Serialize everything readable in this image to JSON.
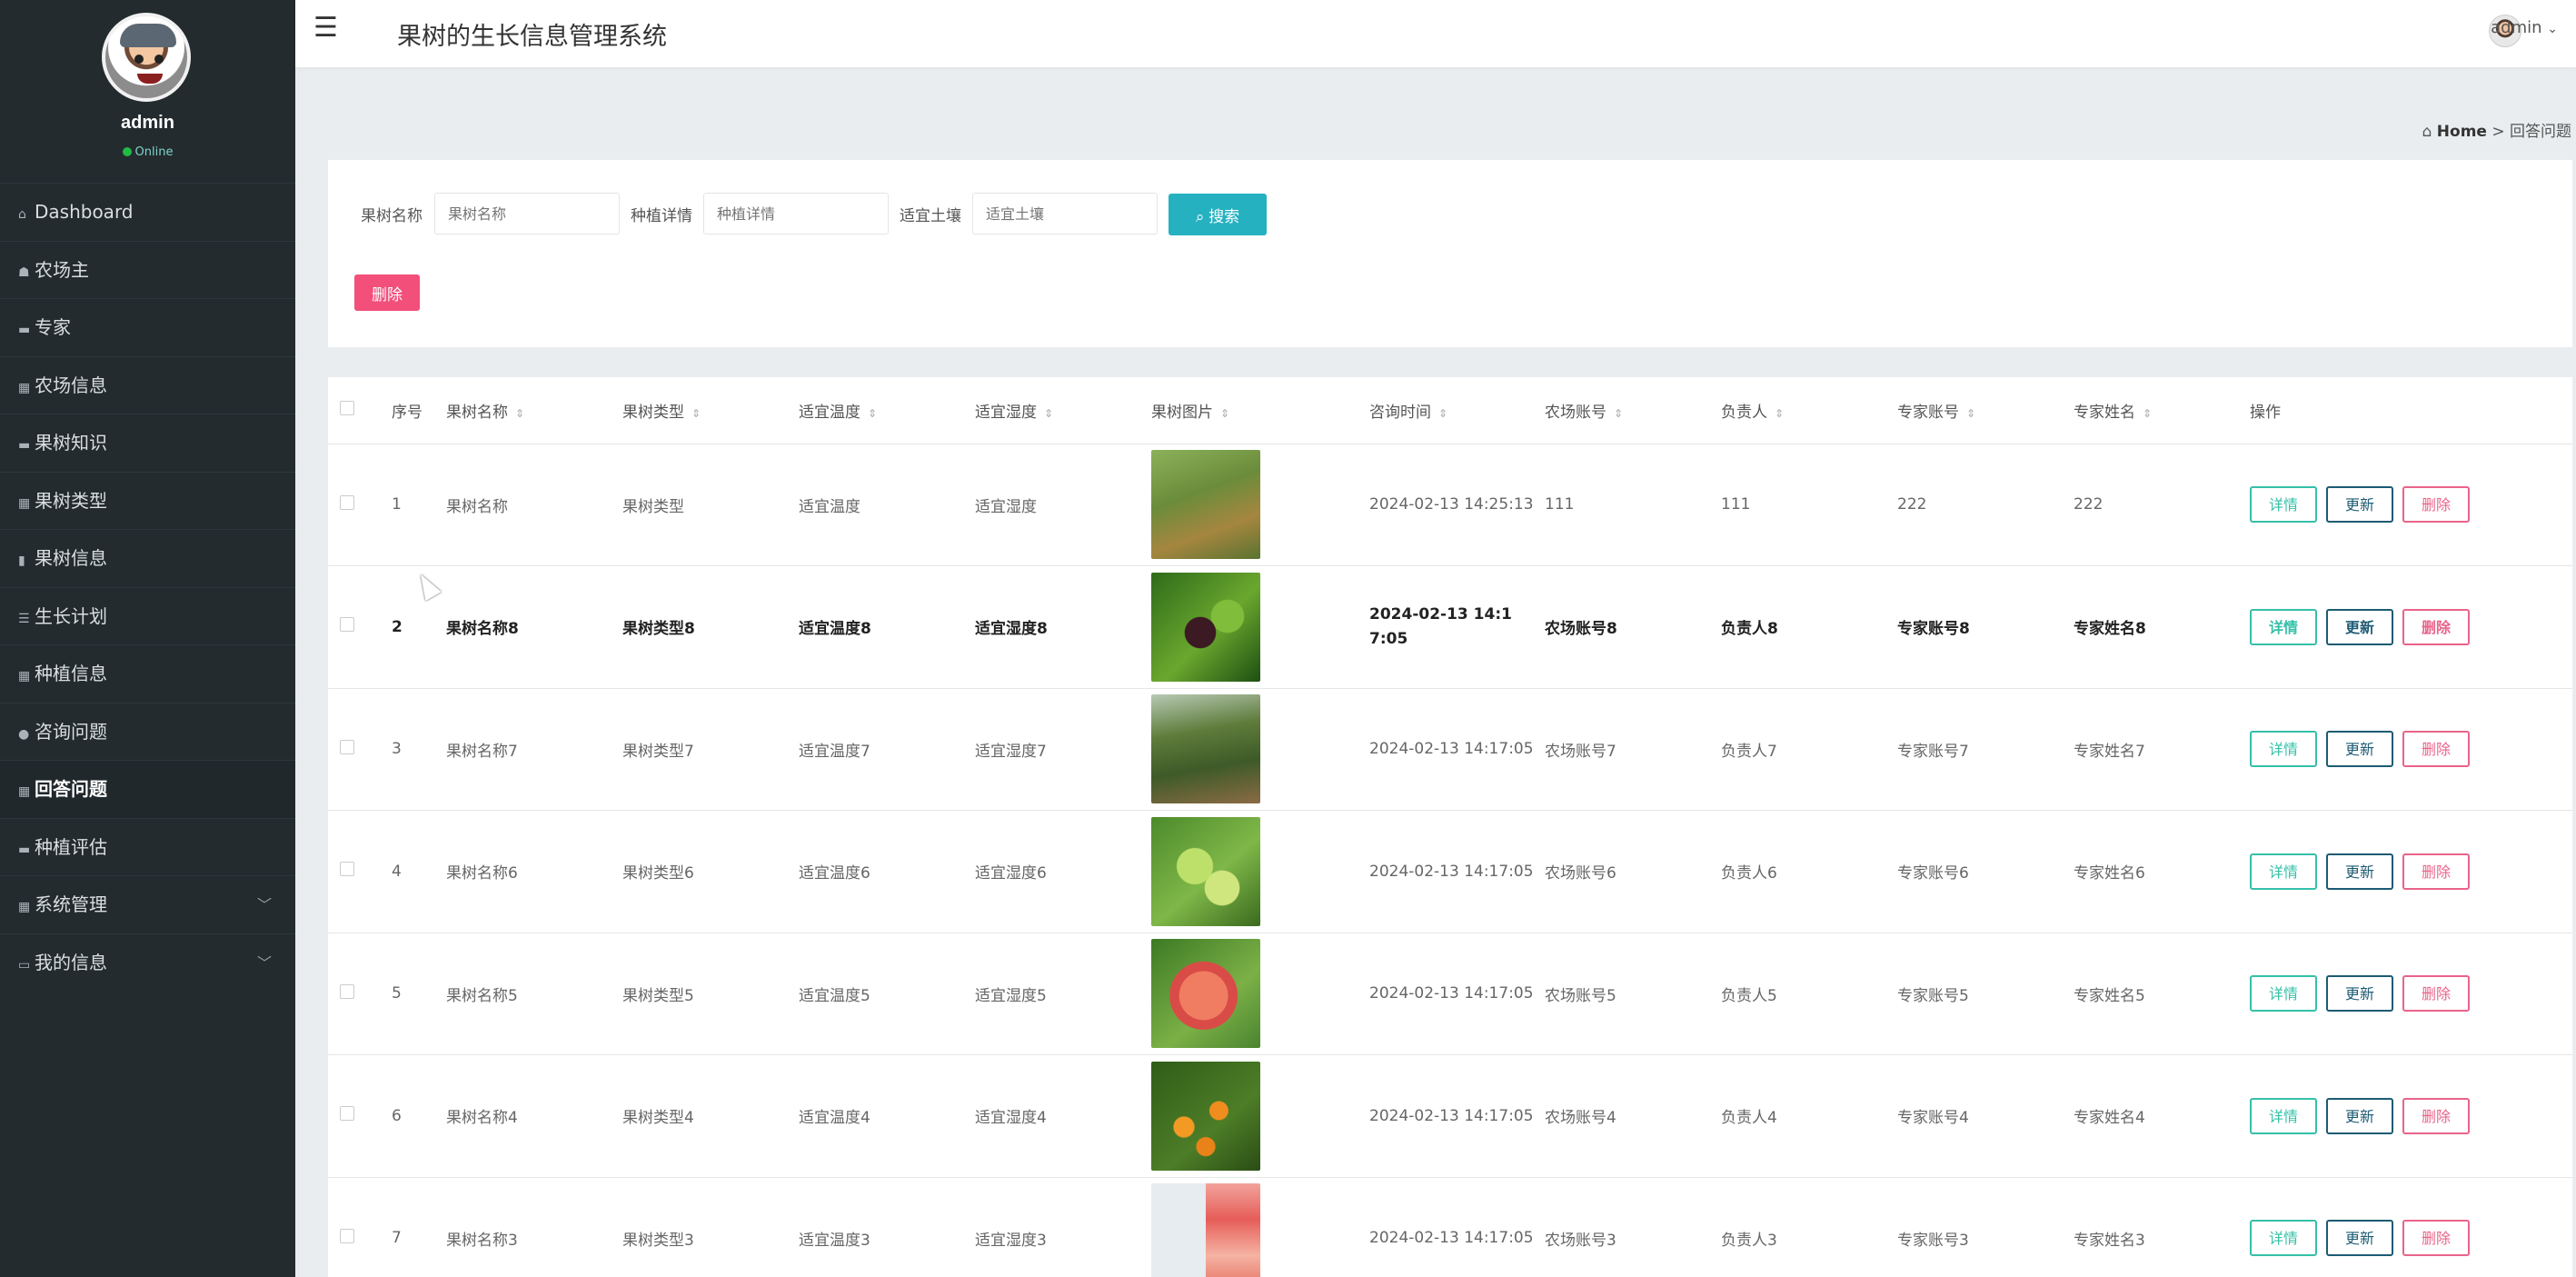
{
  "app": {
    "title": "果树的生长信息管理系统",
    "top_user": "admin"
  },
  "sidebar": {
    "username": "admin",
    "status": "Online",
    "items": [
      {
        "label": "Dashboard",
        "icon": "home-icon"
      },
      {
        "label": "农场主",
        "icon": "user-icon"
      },
      {
        "label": "专家",
        "icon": "user-icon"
      },
      {
        "label": "农场信息",
        "icon": "grid-icon"
      },
      {
        "label": "果树知识",
        "icon": "book-icon"
      },
      {
        "label": "果树类型",
        "icon": "grid-icon"
      },
      {
        "label": "果树信息",
        "icon": "book-icon"
      },
      {
        "label": "生长计划",
        "icon": "list-icon"
      },
      {
        "label": "种植信息",
        "icon": "grid-icon"
      },
      {
        "label": "咨询问题",
        "icon": "location-icon"
      },
      {
        "label": "回答问题",
        "icon": "grid-icon",
        "active": true
      },
      {
        "label": "种植评估",
        "icon": "book-icon"
      },
      {
        "label": "系统管理",
        "icon": "grid-icon",
        "expandable": true
      },
      {
        "label": "我的信息",
        "icon": "card-icon",
        "expandable": true
      }
    ]
  },
  "breadcrumb": {
    "home": "Home",
    "sep": ">",
    "current": "回答问题"
  },
  "search": {
    "fields": [
      {
        "label": "果树名称",
        "placeholder": "果树名称"
      },
      {
        "label": "种植详情",
        "placeholder": "种植详情"
      },
      {
        "label": "适宜土壤",
        "placeholder": "适宜土壤"
      }
    ],
    "search_label": "搜索",
    "delete_label": "删除"
  },
  "table": {
    "columns": [
      "序号",
      "果树名称",
      "果树类型",
      "适宜温度",
      "适宜湿度",
      "果树图片",
      "咨询时间",
      "农场账号",
      "负责人",
      "专家账号",
      "专家姓名",
      "操作"
    ],
    "actions": {
      "detail": "详情",
      "update": "更新",
      "delete": "删除"
    },
    "rows": [
      {
        "idx": "1",
        "name": "果树名称",
        "type": "果树类型",
        "temp": "适宜温度",
        "humid": "适宜湿度",
        "time": "2024-02-13 14:25:13",
        "farm": "111",
        "owner": "111",
        "expert_acct": "222",
        "expert_name": "222"
      },
      {
        "idx": "2",
        "name": "果树名称8",
        "type": "果树类型8",
        "temp": "适宜温度8",
        "humid": "适宜湿度8",
        "time": "2024-02-13 14:17:05",
        "farm": "农场账号8",
        "owner": "负责人8",
        "expert_acct": "专家账号8",
        "expert_name": "专家姓名8"
      },
      {
        "idx": "3",
        "name": "果树名称7",
        "type": "果树类型7",
        "temp": "适宜温度7",
        "humid": "适宜湿度7",
        "time": "2024-02-13 14:17:05",
        "farm": "农场账号7",
        "owner": "负责人7",
        "expert_acct": "专家账号7",
        "expert_name": "专家姓名7"
      },
      {
        "idx": "4",
        "name": "果树名称6",
        "type": "果树类型6",
        "temp": "适宜温度6",
        "humid": "适宜湿度6",
        "time": "2024-02-13 14:17:05",
        "farm": "农场账号6",
        "owner": "负责人6",
        "expert_acct": "专家账号6",
        "expert_name": "专家姓名6"
      },
      {
        "idx": "5",
        "name": "果树名称5",
        "type": "果树类型5",
        "temp": "适宜温度5",
        "humid": "适宜湿度5",
        "time": "2024-02-13 14:17:05",
        "farm": "农场账号5",
        "owner": "负责人5",
        "expert_acct": "专家账号5",
        "expert_name": "专家姓名5"
      },
      {
        "idx": "6",
        "name": "果树名称4",
        "type": "果树类型4",
        "temp": "适宜温度4",
        "humid": "适宜湿度4",
        "time": "2024-02-13 14:17:05",
        "farm": "农场账号4",
        "owner": "负责人4",
        "expert_acct": "专家账号4",
        "expert_name": "专家姓名4"
      },
      {
        "idx": "7",
        "name": "果树名称3",
        "type": "果树类型3",
        "temp": "适宜温度3",
        "humid": "适宜湿度3",
        "time": "2024-02-13 14:17:05",
        "farm": "农场账号3",
        "owner": "负责人3",
        "expert_acct": "专家账号3",
        "expert_name": "专家姓名3"
      }
    ]
  }
}
